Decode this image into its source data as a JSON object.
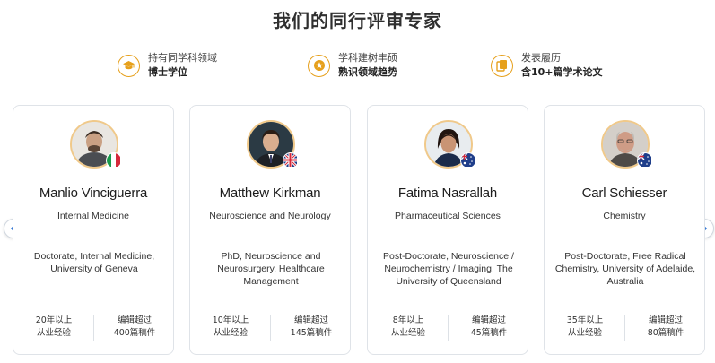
{
  "page": {
    "title": "我们的同行评审专家"
  },
  "features": [
    {
      "icon": "graduation-cap-icon",
      "line1": "持有同学科领域",
      "line2": "博士学位"
    },
    {
      "icon": "star-badge-icon",
      "line1": "学科建树丰硕",
      "line2": "熟识领域趋势"
    },
    {
      "icon": "documents-icon",
      "line1": "发表履历",
      "line2": "含10+篇学术论文"
    }
  ],
  "experts": [
    {
      "name": "Manlio Vinciguerra",
      "field": "Internal Medicine",
      "education": "Doctorate, Internal Medicine, University of Geneva",
      "flag": "italy-flag-icon",
      "years_value": "20年以上",
      "years_label": "从业经验",
      "edits_value": "编辑超过",
      "edits_label": "400篇稿件"
    },
    {
      "name": "Matthew Kirkman",
      "field": "Neuroscience and Neurology",
      "education": "PhD, Neuroscience and Neurosurgery, Healthcare Management",
      "flag": "uk-flag-icon",
      "years_value": "10年以上",
      "years_label": "从业经验",
      "edits_value": "编辑超过",
      "edits_label": "145篇稿件"
    },
    {
      "name": "Fatima Nasrallah",
      "field": "Pharmaceutical Sciences",
      "education": "Post-Doctorate, Neuroscience / Neurochemistry / Imaging, The University of Queensland",
      "flag": "australia-flag-icon",
      "years_value": "8年以上",
      "years_label": "从业经验",
      "edits_value": "编辑超过",
      "edits_label": "45篇稿件"
    },
    {
      "name": "Carl Schiesser",
      "field": "Chemistry",
      "education": "Post-Doctorate, Free Radical Chemistry, University of Adelaide, Australia",
      "flag": "australia-flag-icon",
      "years_value": "35年以上",
      "years_label": "从业经验",
      "edits_value": "编辑超过",
      "edits_label": "80篇稿件"
    }
  ],
  "colors": {
    "accent": "#e6a01c",
    "card_border": "#dfe3e8",
    "nav_arrow": "#3a7bd5"
  }
}
